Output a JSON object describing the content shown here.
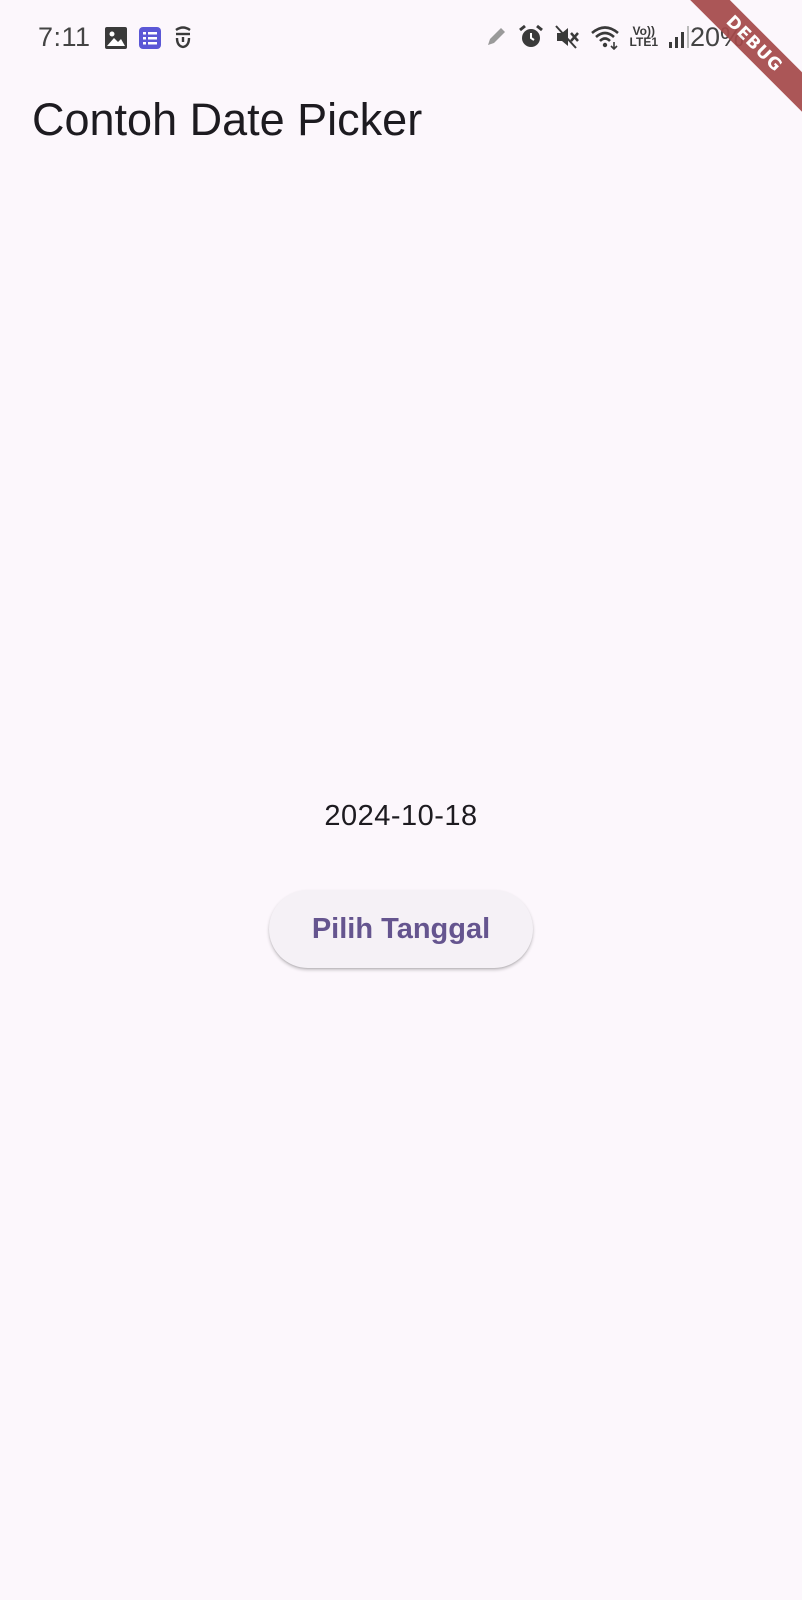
{
  "status_bar": {
    "time": "7:11",
    "battery": "20%",
    "left_icons": [
      "image-icon",
      "task-list-icon",
      "app-icon"
    ],
    "right_icons": [
      "pen-icon",
      "alarm-icon",
      "mute-icon",
      "wifi-icon",
      "volte-icon",
      "signal-icon",
      "battery-icon"
    ],
    "volte_label_top": "Vo))",
    "volte_label_bottom": "LTE1"
  },
  "debug_banner": {
    "label": "DEBUG",
    "color": "#a5494a"
  },
  "app_bar": {
    "title": "Contoh Date Picker"
  },
  "main": {
    "selected_date": "2024-10-18",
    "pick_button_label": "Pilih Tanggal"
  },
  "colors": {
    "background": "#fcf7fc",
    "primary": "#65558f",
    "button_surface": "#f5f1f6"
  }
}
